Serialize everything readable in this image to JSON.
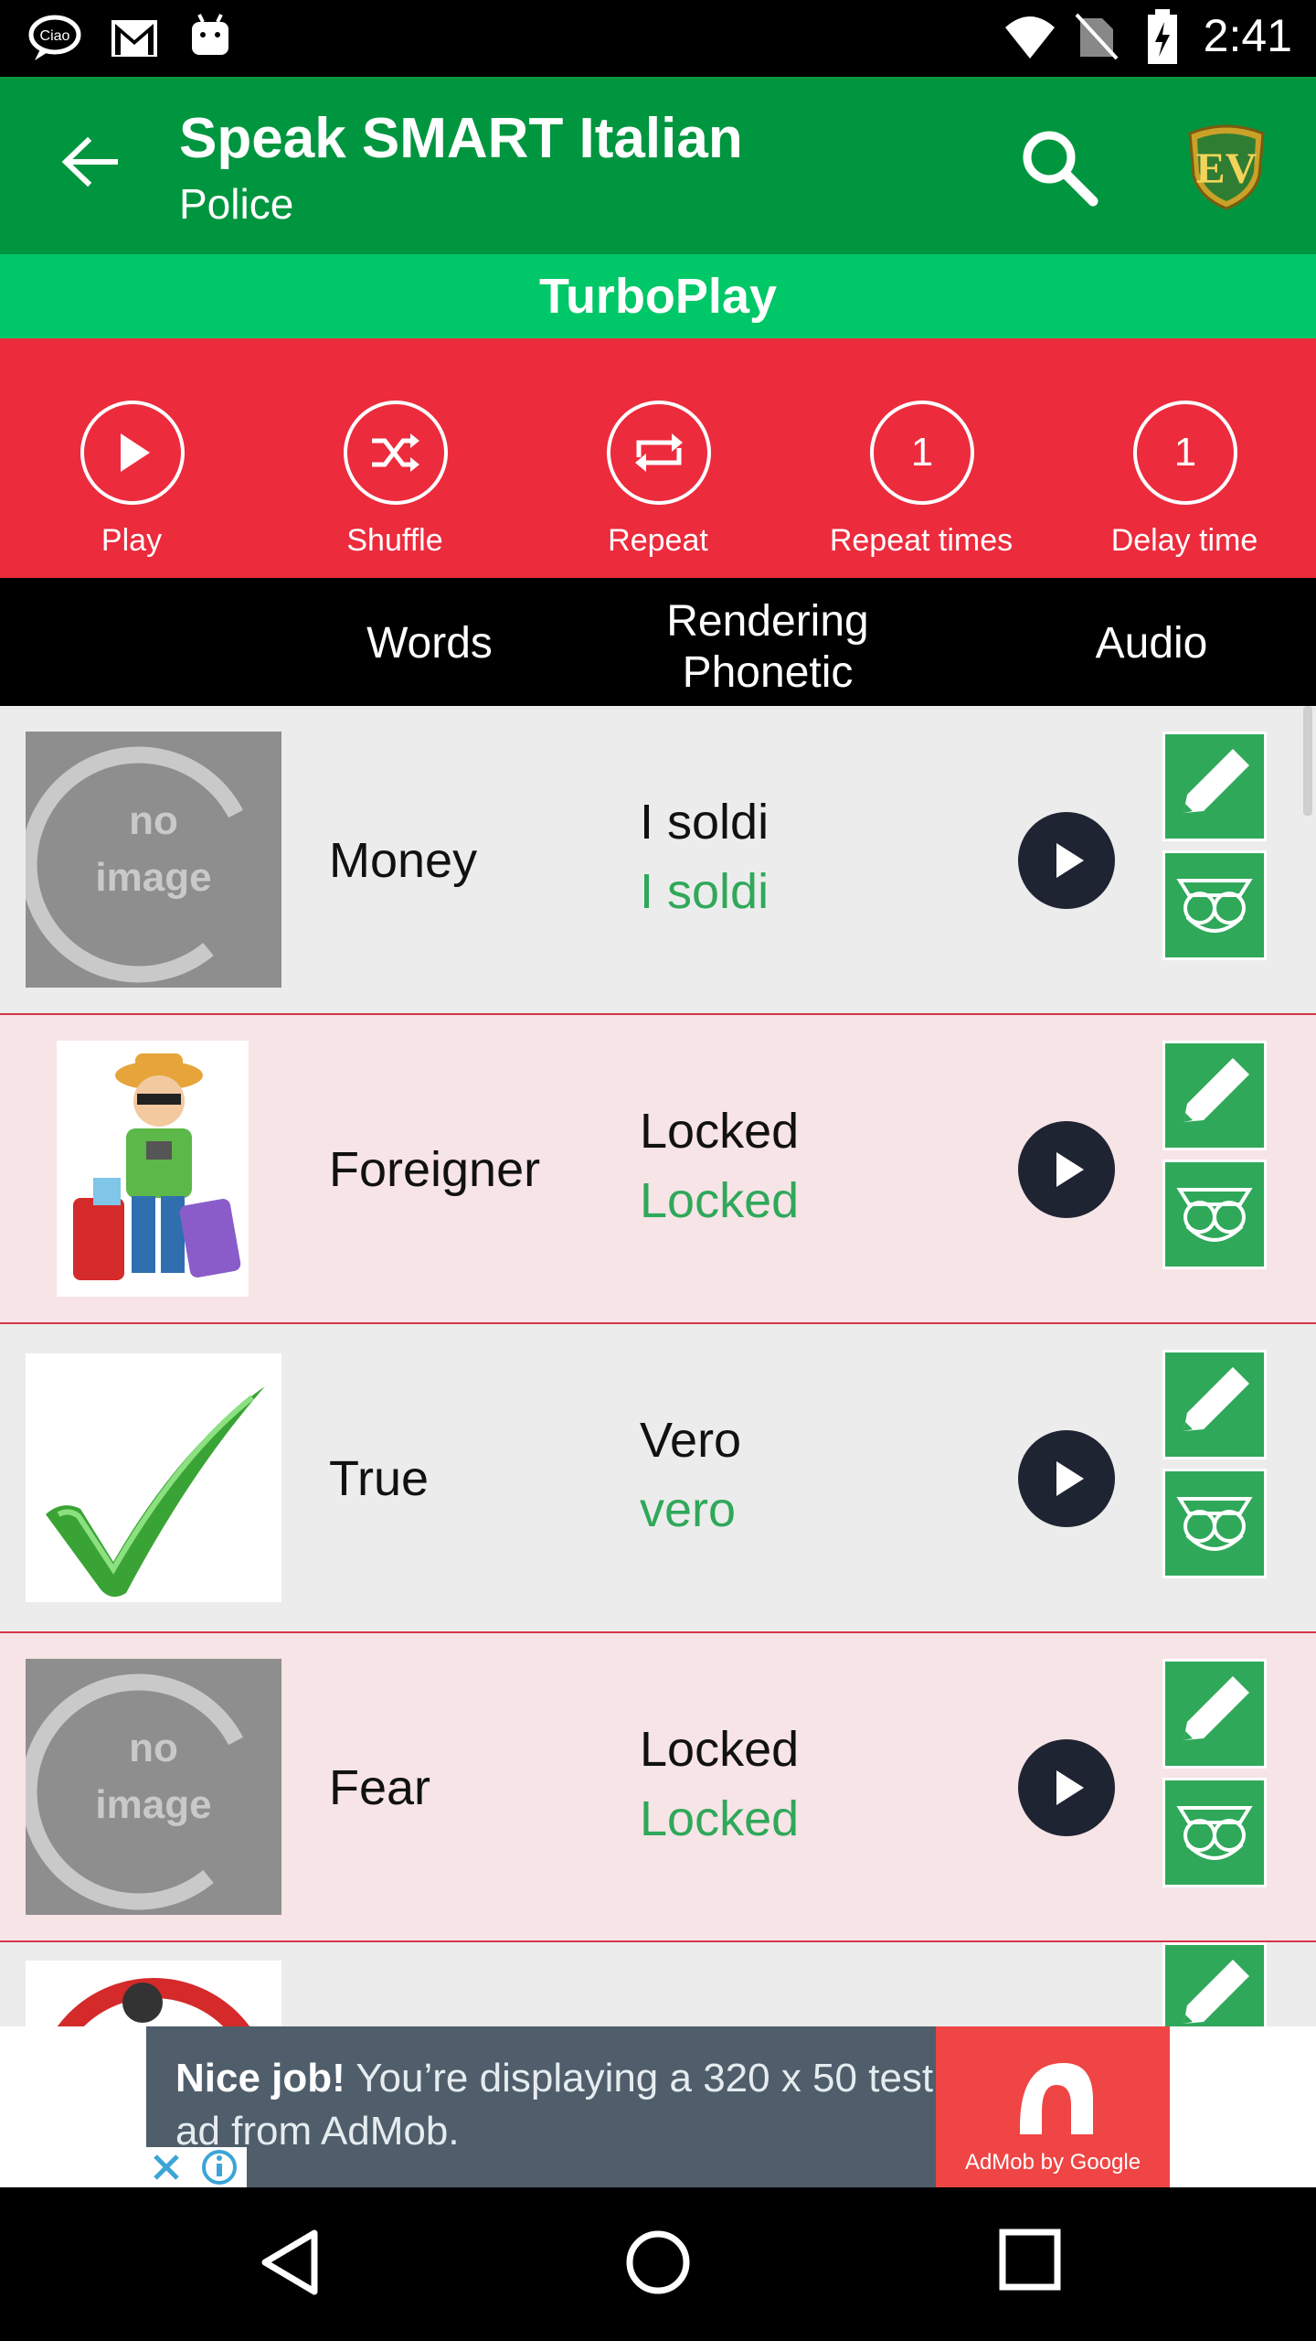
{
  "status_bar": {
    "time": "2:41",
    "icons": [
      "ciao-app-icon",
      "gmail-icon",
      "android-icon",
      "wifi-icon",
      "no-sim-icon",
      "battery-charging-icon"
    ]
  },
  "app_bar": {
    "title": "Speak SMART Italian",
    "subtitle": "Police",
    "back_icon": "arrow-left-icon",
    "search_icon": "search-icon",
    "logo": "EV"
  },
  "turbo_play": {
    "label": "TurboPlay"
  },
  "controls": [
    {
      "label": "Play",
      "icon": "play-icon"
    },
    {
      "label": "Shuffle",
      "icon": "shuffle-icon"
    },
    {
      "label": "Repeat",
      "icon": "repeat-icon"
    },
    {
      "label": "Repeat times",
      "value": "1"
    },
    {
      "label": "Delay time",
      "value": "1"
    }
  ],
  "table_header": {
    "words": "Words",
    "rendering_line1": "Rendering",
    "rendering_line2": "Phonetic",
    "audio": "Audio"
  },
  "rows": [
    {
      "word": "Money",
      "rendering": "I soldi",
      "phonetic": "I soldi",
      "image": "no-image-placeholder",
      "image_text_1": "no",
      "image_text_2": "image"
    },
    {
      "word": "Foreigner",
      "rendering": "Locked",
      "phonetic": "Locked",
      "image": "tourist-with-suitcases"
    },
    {
      "word": "True",
      "rendering": "Vero",
      "phonetic": "vero",
      "image": "green-checkmark"
    },
    {
      "word": "Fear",
      "rendering": "Locked",
      "phonetic": "Locked",
      "image": "no-image-placeholder",
      "image_text_1": "no",
      "image_text_2": "image"
    },
    {
      "word": "",
      "rendering": "",
      "phonetic": "",
      "image": "prohibition-sign"
    }
  ],
  "ad": {
    "headline": "Nice job!",
    "text": " You’re displaying a 320 x 50 test ad from AdMob.",
    "brand": "AdMob by Google"
  },
  "nav_bar": {
    "icons": [
      "back-triangle-icon",
      "home-circle-icon",
      "recents-square-icon"
    ]
  },
  "colors": {
    "app_bar": "#00963f",
    "turbo_play": "#00c767",
    "controls": "#ec2b3d",
    "phonetic_text": "#2fa85a",
    "row_separator": "#d3374a"
  }
}
